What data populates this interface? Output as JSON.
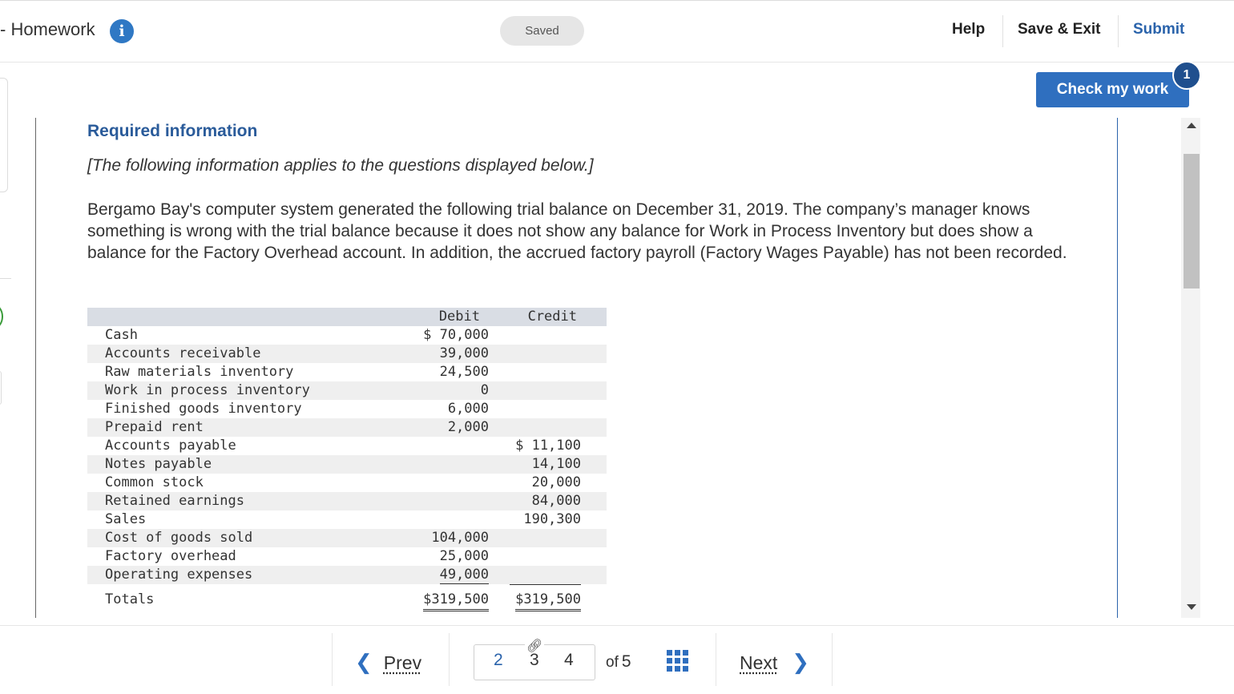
{
  "header": {
    "title": "- Homework",
    "info_icon": "info-icon",
    "saved": "Saved",
    "help": "Help",
    "save_exit": "Save & Exit",
    "submit": "Submit"
  },
  "check": {
    "label": "Check my work",
    "badge": "1"
  },
  "content": {
    "required_title": "Required information",
    "note": "[The following information applies to the questions displayed below.]",
    "paragraph": "Bergamo Bay's computer system generated the following trial balance on December 31, 2019. The company’s manager knows something is wrong with the trial balance because it does not show any balance for Work in Process Inventory but does show a balance for the Factory Overhead account. In addition, the accrued factory payroll (Factory Wages Payable) has not been recorded."
  },
  "table": {
    "head_debit": "Debit",
    "head_credit": "Credit",
    "rows": [
      {
        "name": "Cash",
        "debit": "$ 70,000",
        "credit": ""
      },
      {
        "name": "Accounts receivable",
        "debit": "39,000",
        "credit": ""
      },
      {
        "name": "Raw materials inventory",
        "debit": "24,500",
        "credit": ""
      },
      {
        "name": "Work in process inventory",
        "debit": "0",
        "credit": ""
      },
      {
        "name": "Finished goods inventory",
        "debit": "6,000",
        "credit": ""
      },
      {
        "name": "Prepaid rent",
        "debit": "2,000",
        "credit": ""
      },
      {
        "name": "Accounts payable",
        "debit": "",
        "credit": "$ 11,100"
      },
      {
        "name": "Notes payable",
        "debit": "",
        "credit": "14,100"
      },
      {
        "name": "Common stock",
        "debit": "",
        "credit": "20,000"
      },
      {
        "name": "Retained earnings",
        "debit": "",
        "credit": "84,000"
      },
      {
        "name": "Sales",
        "debit": "",
        "credit": "190,300"
      },
      {
        "name": "Cost of goods sold",
        "debit": "104,000",
        "credit": ""
      },
      {
        "name": "Factory overhead",
        "debit": "25,000",
        "credit": ""
      },
      {
        "name": "Operating expenses",
        "debit": "49,000",
        "credit": ""
      }
    ],
    "totals_label": "Totals",
    "totals_debit": "$319,500",
    "totals_credit": "$319,500"
  },
  "footer": {
    "prev": "Prev",
    "pages": [
      "2",
      "3",
      "4"
    ],
    "current_page": "2",
    "of_label": "of",
    "total_pages": "5",
    "next": "Next",
    "link_icon": "link-icon",
    "grid_icon": "grid-icon"
  }
}
